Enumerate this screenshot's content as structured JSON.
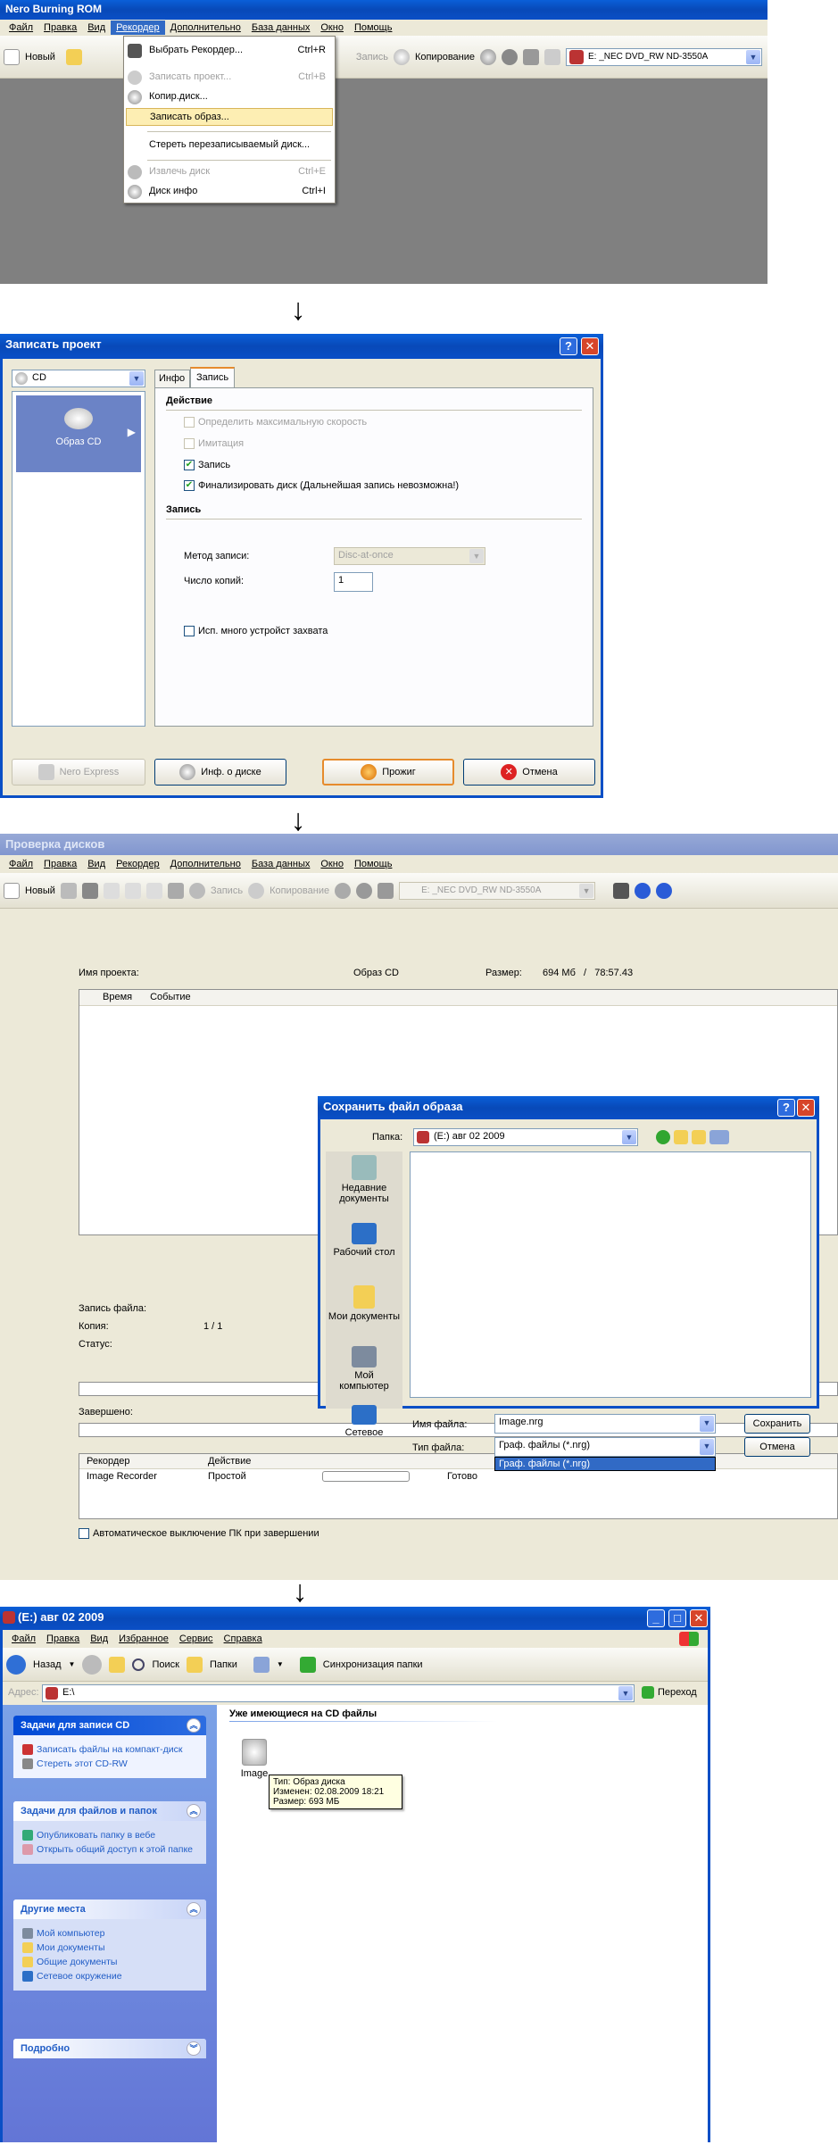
{
  "nero1": {
    "title": "Nero Burning ROM",
    "menu": [
      "Файл",
      "Правка",
      "Вид",
      "Рекордер",
      "Дополнительно",
      "База данных",
      "Окно",
      "Помощь"
    ],
    "toolbar": {
      "new_label": "Новый",
      "write_label": "Запись",
      "copy_label": "Копирование",
      "drive": "E: _NEC DVD_RW ND-3550A"
    },
    "dropdown": [
      {
        "label": "Выбрать Рекордер...",
        "shortcut": "Ctrl+R",
        "enabled": true
      },
      {
        "label": "Записать проект...",
        "shortcut": "Ctrl+B",
        "enabled": false
      },
      {
        "label": "Копир.диск...",
        "shortcut": "",
        "enabled": true
      },
      {
        "label": "Записать образ...",
        "shortcut": "",
        "enabled": true,
        "highlighted": true
      },
      {
        "label": "Стереть перезаписываемый диск...",
        "shortcut": "",
        "enabled": true
      },
      {
        "label": "Извлечь диск",
        "shortcut": "Ctrl+E",
        "enabled": false
      },
      {
        "label": "Диск инфо",
        "shortcut": "Ctrl+I",
        "enabled": true
      }
    ]
  },
  "dialog": {
    "title": "Записать проект",
    "media": "CD",
    "tabs": [
      "Инфо",
      "Запись"
    ],
    "left_item": "Образ CD",
    "section_action": "Действие",
    "options": [
      {
        "label": "Определить максимальную скорость",
        "checked": false,
        "enabled": false
      },
      {
        "label": "Имитация",
        "checked": false,
        "enabled": false
      },
      {
        "label": "Запись",
        "checked": true,
        "enabled": true
      },
      {
        "label": "Финализировать диск (Дальнейшая запись невозможна!)",
        "checked": true,
        "enabled": true
      }
    ],
    "section_write": "Запись",
    "write_method_label": "Метод записи:",
    "write_method_value": "Disc-at-once",
    "copies_label": "Число копий:",
    "copies_value": "1",
    "multi_device": "Исп. много устройст захвата",
    "buttons": {
      "express": "Nero Express",
      "info": "Инф. о диске",
      "burn": "Прожиг",
      "cancel": "Отмена"
    }
  },
  "nero2": {
    "title": "Проверка дисков",
    "menu": [
      "Файл",
      "Правка",
      "Вид",
      "Рекордер",
      "Дополнительно",
      "База данных",
      "Окно",
      "Помощь"
    ],
    "toolbar": {
      "new_label": "Новый",
      "write_label": "Запись",
      "copy_label": "Копирование",
      "drive": "E: _NEC DVD_RW ND-3550A"
    },
    "project_label": "Имя проекта:",
    "project_value": "Образ CD",
    "size_label": "Размер:",
    "size_value": "694 Мб   /   78:57.43",
    "log_cols": [
      "Время",
      "Событие"
    ],
    "write_file": "Запись файла:",
    "copy_label": "Копия:",
    "copy_value": "1 / 1",
    "status_label": "Статус:",
    "finished_label": "Завершено:",
    "rec_cols": [
      "Рекордер",
      "Действие"
    ],
    "rec_row": {
      "rec": "Image Recorder",
      "act": "Простой",
      "status": "Готово"
    },
    "autoshutdown": "Автоматическое выключение ПК при завершении"
  },
  "savedlg": {
    "title": "Сохранить файл образа",
    "folder_label": "Папка:",
    "folder_value": "(E:) авг 02 2009",
    "places": [
      "Недавние документы",
      "Рабочий стол",
      "Мои документы",
      "Мой компьютер",
      "Сетевое"
    ],
    "filename_label": "Имя файла:",
    "filename_value": "Image.nrg",
    "filetype_label": "Тип файла:",
    "filetype_value": "Граф. файлы (*.nrg)",
    "filetype_option": "Граф. файлы (*.nrg)",
    "save": "Сохранить",
    "cancel": "Отмена"
  },
  "explorer": {
    "title": "(E:) авг 02 2009",
    "menu": [
      "Файл",
      "Правка",
      "Вид",
      "Избранное",
      "Сервис",
      "Справка"
    ],
    "back": "Назад",
    "search": "Поиск",
    "folders": "Папки",
    "sync": "Синхронизация папки",
    "address_label": "Адрес:",
    "address_value": "E:\\",
    "go": "Переход",
    "group_header": "Уже имеющиеся на CD файлы",
    "file_name": "Image",
    "tooltip": [
      "Тип: Образ диска",
      "Изменен: 02.08.2009 18:21",
      "Размер: 693 МБ"
    ],
    "panels": [
      {
        "title": "Задачи для записи CD",
        "items": [
          "Записать файлы на компакт-диск",
          "Стереть этот CD-RW"
        ]
      },
      {
        "title": "Задачи для файлов и папок",
        "items": [
          "Опубликовать папку в вебе",
          "Открыть общий доступ к этой папке"
        ]
      },
      {
        "title": "Другие места",
        "items": [
          "Мой компьютер",
          "Мои документы",
          "Общие документы",
          "Сетевое окружение"
        ]
      },
      {
        "title": "Подробно",
        "items": []
      }
    ]
  },
  "arrow": "↓"
}
